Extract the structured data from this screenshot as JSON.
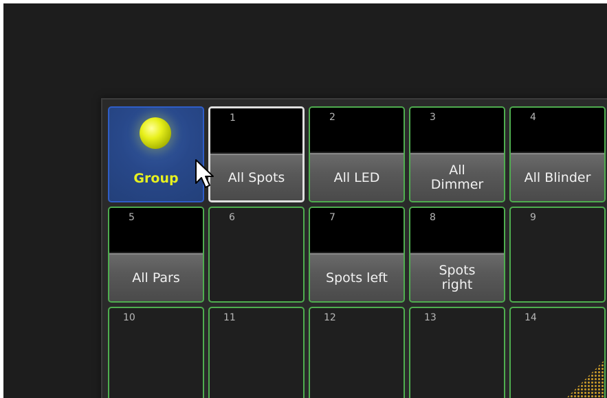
{
  "pool": {
    "title": {
      "label": "Group",
      "icon": "sphere-icon"
    },
    "cells": [
      {
        "num": "1",
        "label": "All Spots"
      },
      {
        "num": "2",
        "label": "All LED"
      },
      {
        "num": "3",
        "label": "All Dimmer"
      },
      {
        "num": "4",
        "label": "All Blinder"
      },
      {
        "num": "5",
        "label": "All Pars"
      },
      {
        "num": "6",
        "label": ""
      },
      {
        "num": "7",
        "label": "Spots left"
      },
      {
        "num": "8",
        "label": "Spots right"
      },
      {
        "num": "9",
        "label": ""
      },
      {
        "num": "10",
        "label": ""
      },
      {
        "num": "11",
        "label": ""
      },
      {
        "num": "12",
        "label": ""
      },
      {
        "num": "13",
        "label": ""
      },
      {
        "num": "14",
        "label": ""
      }
    ]
  },
  "colors": {
    "assigned_border": "#4fae4f",
    "title_blue": "#2f5ec8",
    "title_text": "#e6f020",
    "selected_border": "#e0e0e0"
  }
}
